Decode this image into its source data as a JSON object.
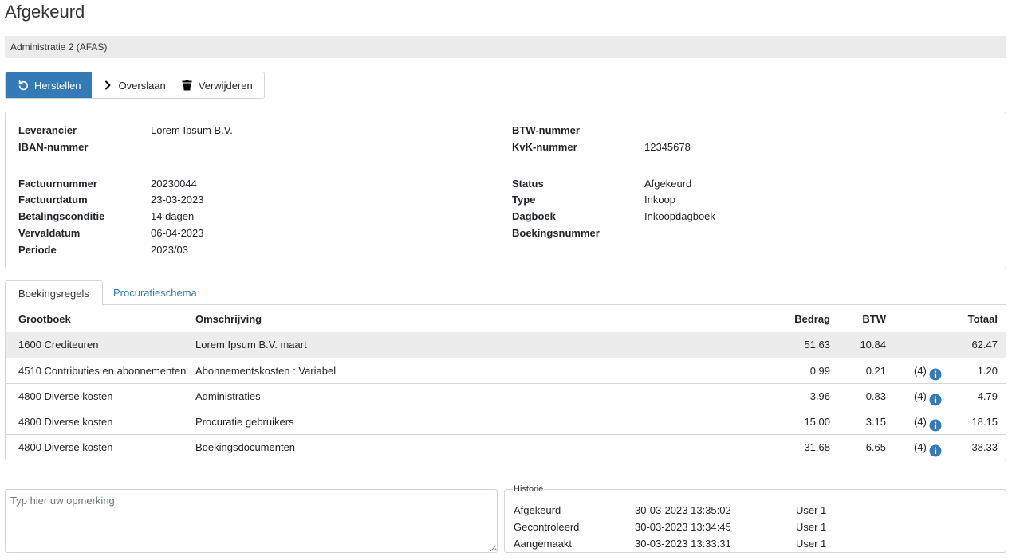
{
  "page": {
    "title": "Afgekeurd"
  },
  "admin": {
    "label": "Administratie 2 (AFAS)"
  },
  "toolbar": {
    "restore_label": "Herstellen",
    "skip_label": "Overslaan",
    "delete_label": "Verwijderen",
    "primary_color": "#337ab7"
  },
  "supplier": {
    "leverancier_label": "Leverancier",
    "leverancier_value": "Lorem Ipsum B.V.",
    "iban_label": "IBAN-nummer",
    "iban_value": "",
    "btw_label": "BTW-nummer",
    "btw_value": "",
    "kvk_label": "KvK-nummer",
    "kvk_value": "12345678"
  },
  "invoice": {
    "factuurnummer_label": "Factuurnummer",
    "factuurnummer_value": "20230044",
    "factuurdatum_label": "Factuurdatum",
    "factuurdatum_value": "23-03-2023",
    "betalingsconditie_label": "Betalingsconditie",
    "betalingsconditie_value": "14 dagen",
    "vervaldatum_label": "Vervaldatum",
    "vervaldatum_value": "06-04-2023",
    "periode_label": "Periode",
    "periode_value": "2023/03",
    "status_label": "Status",
    "status_value": "Afgekeurd",
    "type_label": "Type",
    "type_value": "Inkoop",
    "dagboek_label": "Dagboek",
    "dagboek_value": "Inkoopdagboek",
    "boekingsnummer_label": "Boekingsnummer",
    "boekingsnummer_value": ""
  },
  "tabs": [
    {
      "label": "Boekingsregels",
      "active": true
    },
    {
      "label": "Procuratieschema",
      "active": false
    }
  ],
  "table": {
    "headers": {
      "grootboek": "Grootboek",
      "omschrijving": "Omschrijving",
      "bedrag": "Bedrag",
      "btw": "BTW",
      "totaal": "Totaal"
    },
    "rows": [
      {
        "grootboek": "1600 Crediteuren",
        "omschrijving": "Lorem Ipsum B.V. maart",
        "bedrag": "51.63",
        "btw": "10.84",
        "count": "",
        "totaal": "62.47"
      },
      {
        "grootboek": "4510 Contributies en abonnementen",
        "omschrijving": "Abonnementskosten : Variabel",
        "bedrag": "0.99",
        "btw": "0.21",
        "count": "(4)",
        "totaal": "1.20"
      },
      {
        "grootboek": "4800 Diverse kosten",
        "omschrijving": "Administraties",
        "bedrag": "3.96",
        "btw": "0.83",
        "count": "(4)",
        "totaal": "4.79"
      },
      {
        "grootboek": "4800 Diverse kosten",
        "omschrijving": "Procuratie gebruikers",
        "bedrag": "15.00",
        "btw": "3.15",
        "count": "(4)",
        "totaal": "18.15"
      },
      {
        "grootboek": "4800 Diverse kosten",
        "omschrijving": "Boekingsdocumenten",
        "bedrag": "31.68",
        "btw": "6.65",
        "count": "(4)",
        "totaal": "38.33"
      }
    ],
    "info_icon_color": "#337ab7"
  },
  "remark": {
    "placeholder": "Typ hier uw opmerking",
    "value": ""
  },
  "history": {
    "legend": "Historie",
    "entries": [
      {
        "status": "Afgekeurd",
        "datetime": "30-03-2023 13:35:02",
        "user": "User 1"
      },
      {
        "status": "Gecontroleerd",
        "datetime": "30-03-2023 13:34:45",
        "user": "User 1"
      },
      {
        "status": "Aangemaakt",
        "datetime": "30-03-2023 13:33:31",
        "user": "User 1"
      }
    ]
  }
}
